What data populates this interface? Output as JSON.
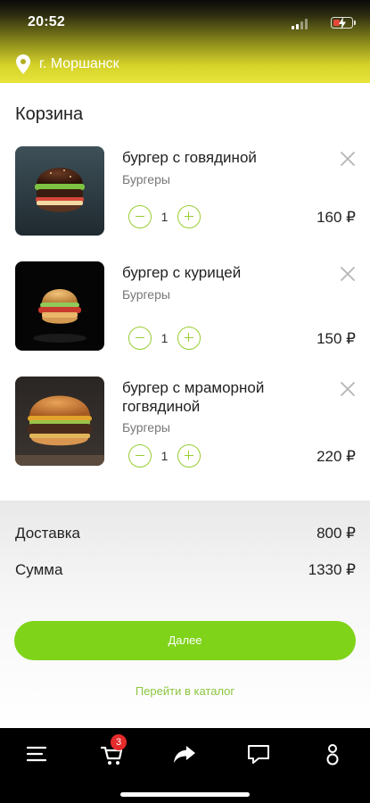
{
  "status_bar": {
    "time": "20:52"
  },
  "location": {
    "city": "г. Моршанск",
    "icon": "location-pin-icon"
  },
  "cart": {
    "title": "Корзина",
    "items": [
      {
        "name": "бургер с говядиной",
        "category": "Бургеры",
        "quantity": "1",
        "price": "160 ₽"
      },
      {
        "name": "бургер с курицей",
        "category": "Бургеры",
        "quantity": "1",
        "price": "150 ₽"
      },
      {
        "name": "бургер с мраморной гогвядиной",
        "category": "Бургеры",
        "quantity": "1",
        "price": "220 ₽"
      }
    ]
  },
  "totals": {
    "delivery_label": "Доставка",
    "delivery_value": "800 ₽",
    "sum_label": "Сумма",
    "sum_value": "1330 ₽"
  },
  "actions": {
    "next_label": "Далее",
    "catalog_link": "Перейти в каталог"
  },
  "bottom_nav": {
    "items": [
      "menu-icon",
      "cart-icon",
      "share-icon",
      "chat-icon",
      "profile-icon"
    ],
    "cart_badge": "3"
  },
  "colors": {
    "accent": "#7fd319",
    "link": "#8cc63f",
    "stepper": "#9acd32",
    "badge": "#e52b2b",
    "header_gradient_end": "#e7e43a"
  }
}
